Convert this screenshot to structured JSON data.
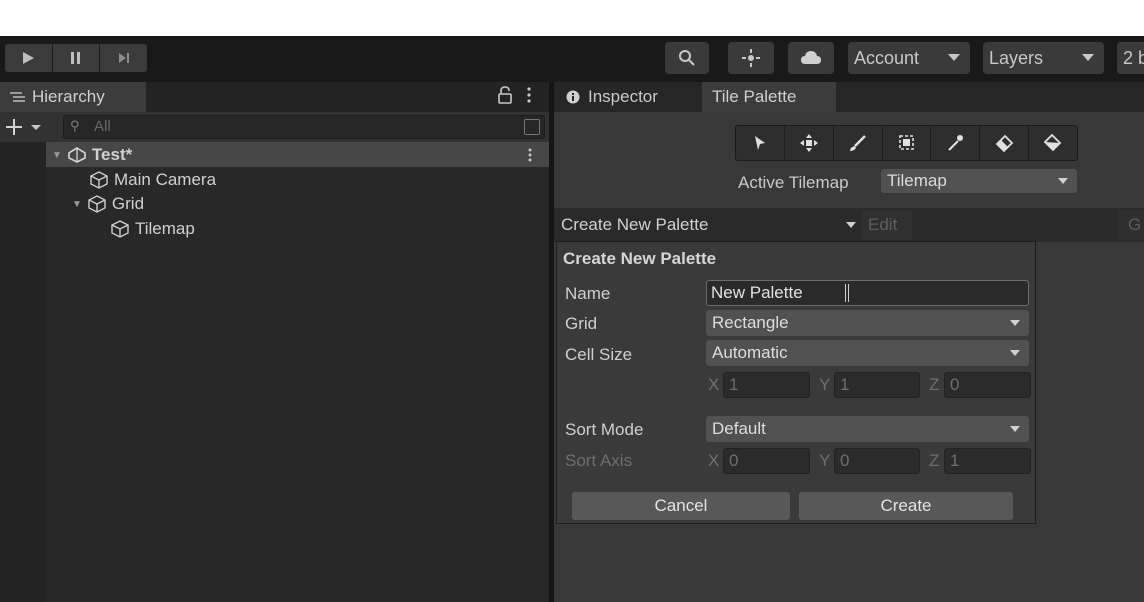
{
  "toolbar": {
    "account_label": "Account",
    "layers_label": "Layers",
    "layout_label": "2 b",
    "icons": [
      "play-icon",
      "pause-icon",
      "step-icon",
      "search-icon",
      "collab-icon",
      "cloud-icon"
    ]
  },
  "hierarchy": {
    "tab_label": "Hierarchy",
    "search_placeholder": "All",
    "scene": "Test*",
    "items": [
      {
        "label": "Main Camera"
      },
      {
        "label": "Grid"
      },
      {
        "label": "Tilemap"
      }
    ]
  },
  "right": {
    "tab_inspector": "Inspector",
    "tab_tile_palette": "Tile Palette",
    "tools": [
      "select-tool-icon",
      "move-tool-icon",
      "paint-brush-icon",
      "box-fill-icon",
      "picker-icon",
      "eraser-icon",
      "fill-bucket-icon"
    ],
    "active_tilemap_label": "Active Tilemap",
    "active_tilemap_value": "Tilemap",
    "palette_dropdown": "Create New Palette",
    "edit_label": "Edit",
    "g_label": "G"
  },
  "dialog": {
    "title": "Create New Palette",
    "name_label": "Name",
    "name_value": "New Palette",
    "grid_label": "Grid",
    "grid_value": "Rectangle",
    "cell_size_label": "Cell Size",
    "cell_size_value": "Automatic",
    "cell": {
      "x": "1",
      "y": "1",
      "z": "0"
    },
    "sort_mode_label": "Sort Mode",
    "sort_mode_value": "Default",
    "sort_axis_label": "Sort Axis",
    "axis": {
      "x": "0",
      "y": "0",
      "z": "1"
    },
    "xyz": {
      "x": "X",
      "y": "Y",
      "z": "Z"
    },
    "cancel_label": "Cancel",
    "create_label": "Create"
  }
}
